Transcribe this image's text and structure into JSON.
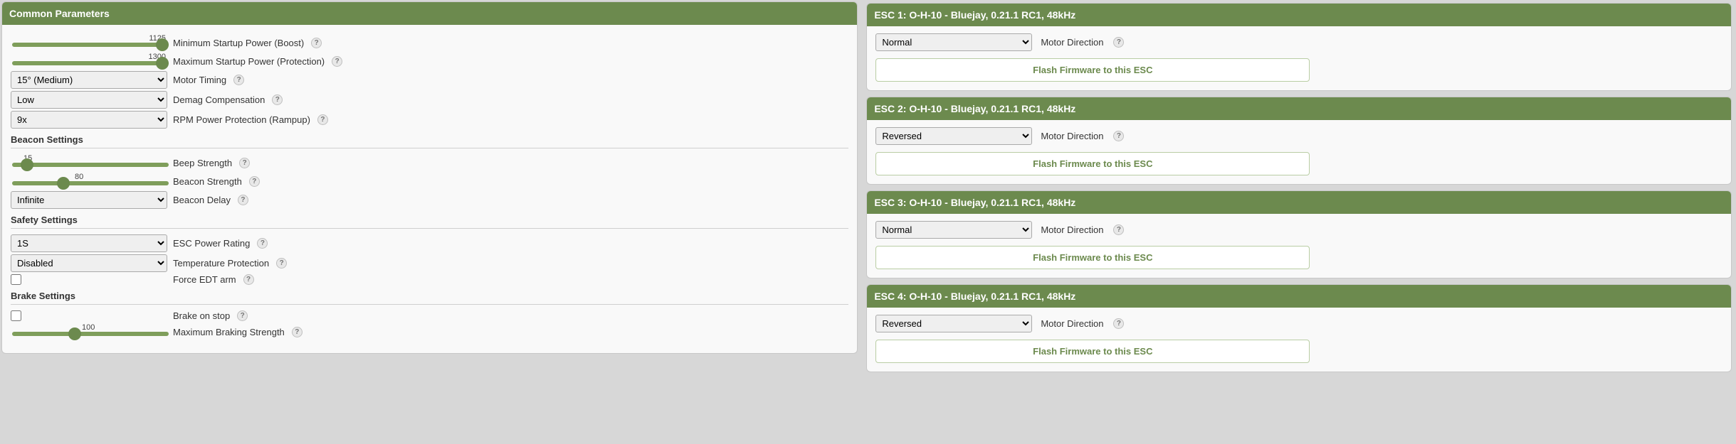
{
  "left": {
    "title": "Common Parameters",
    "min_startup": {
      "value": "1125",
      "label": "Minimum Startup Power (Boost)"
    },
    "max_startup": {
      "value": "1300",
      "label": "Maximum Startup Power (Protection)"
    },
    "motor_timing": {
      "value": "15° (Medium)",
      "label": "Motor Timing"
    },
    "demag": {
      "value": "Low",
      "label": "Demag Compensation"
    },
    "rpm_rampup": {
      "value": "9x",
      "label": "RPM Power Protection (Rampup)"
    },
    "beacon_section": "Beacon Settings",
    "beep_strength": {
      "value": "15",
      "label": "Beep Strength"
    },
    "beacon_strength": {
      "value": "80",
      "label": "Beacon Strength"
    },
    "beacon_delay": {
      "value": "Infinite",
      "label": "Beacon Delay"
    },
    "safety_section": "Safety Settings",
    "power_rating": {
      "value": "1S",
      "label": "ESC Power Rating"
    },
    "temp_prot": {
      "value": "Disabled",
      "label": "Temperature Protection"
    },
    "force_edt": {
      "label": "Force EDT arm"
    },
    "brake_section": "Brake Settings",
    "brake_on_stop": {
      "label": "Brake on stop"
    },
    "max_brake": {
      "value": "100",
      "label": "Maximum Braking Strength"
    }
  },
  "esc": [
    {
      "title": "ESC 1: O-H-10 - Bluejay, 0.21.1 RC1, 48kHz",
      "direction": "Normal",
      "dir_label": "Motor Direction",
      "flash": "Flash Firmware to this ESC"
    },
    {
      "title": "ESC 2: O-H-10 - Bluejay, 0.21.1 RC1, 48kHz",
      "direction": "Reversed",
      "dir_label": "Motor Direction",
      "flash": "Flash Firmware to this ESC"
    },
    {
      "title": "ESC 3: O-H-10 - Bluejay, 0.21.1 RC1, 48kHz",
      "direction": "Normal",
      "dir_label": "Motor Direction",
      "flash": "Flash Firmware to this ESC"
    },
    {
      "title": "ESC 4: O-H-10 - Bluejay, 0.21.1 RC1, 48kHz",
      "direction": "Reversed",
      "dir_label": "Motor Direction",
      "flash": "Flash Firmware to this ESC"
    }
  ]
}
